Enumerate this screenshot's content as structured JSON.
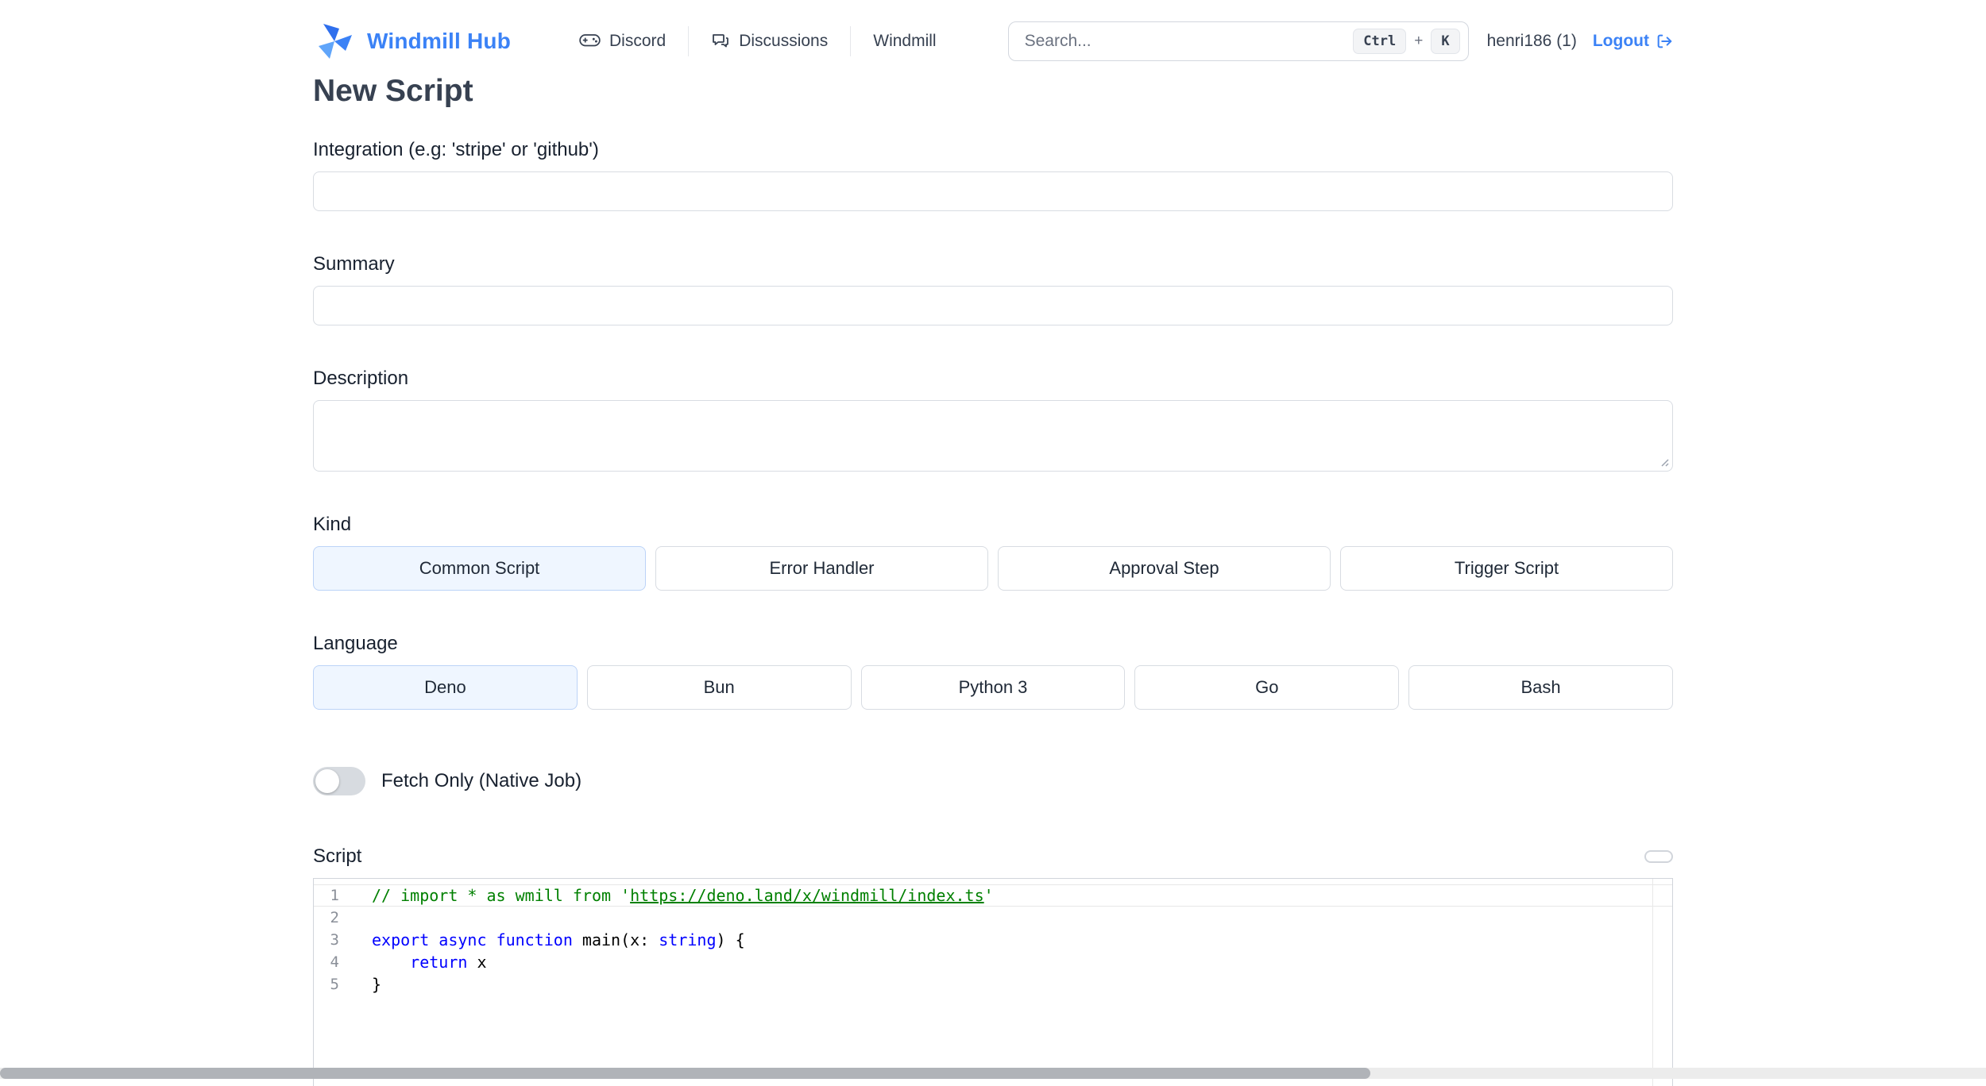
{
  "header": {
    "brand": "Windmill Hub",
    "nav": [
      {
        "label": "Discord"
      },
      {
        "label": "Discussions"
      },
      {
        "label": "Windmill"
      }
    ],
    "search": {
      "placeholder": "Search...",
      "keys": [
        "Ctrl",
        "K"
      ],
      "separator": "+"
    },
    "user": "henri186 (1)",
    "logout_label": "Logout"
  },
  "page": {
    "title": "New Script"
  },
  "form": {
    "integration": {
      "label": "Integration (e.g: 'stripe' or 'github')",
      "value": ""
    },
    "summary": {
      "label": "Summary",
      "value": ""
    },
    "description": {
      "label": "Description",
      "value": ""
    },
    "kind": {
      "label": "Kind",
      "options": [
        "Common Script",
        "Error Handler",
        "Approval Step",
        "Trigger Script"
      ],
      "selected": "Common Script"
    },
    "language": {
      "label": "Language",
      "options": [
        "Deno",
        "Bun",
        "Python 3",
        "Go",
        "Bash"
      ],
      "selected": "Deno"
    },
    "fetch_only": {
      "label": "Fetch Only (Native Job)",
      "enabled": false
    },
    "script": {
      "label": "Script"
    }
  },
  "editor": {
    "line_numbers": [
      "1",
      "2",
      "3",
      "4",
      "5"
    ],
    "lines": [
      {
        "tokens": [
          {
            "t": "// import * as wmill from '",
            "c": "comment"
          },
          {
            "t": "https://deno.land/x/windmill/index.ts",
            "c": "comment-link"
          },
          {
            "t": "'",
            "c": "comment"
          }
        ]
      },
      {
        "tokens": []
      },
      {
        "tokens": [
          {
            "t": "export",
            "c": "keyword"
          },
          {
            "t": " ",
            "c": "plain"
          },
          {
            "t": "async",
            "c": "keyword"
          },
          {
            "t": " ",
            "c": "plain"
          },
          {
            "t": "function",
            "c": "keyword"
          },
          {
            "t": " main(x: ",
            "c": "plain"
          },
          {
            "t": "string",
            "c": "keyword"
          },
          {
            "t": ") {",
            "c": "plain"
          }
        ]
      },
      {
        "tokens": [
          {
            "t": "    ",
            "c": "plain"
          },
          {
            "t": "return",
            "c": "keyword"
          },
          {
            "t": " x",
            "c": "plain"
          }
        ]
      },
      {
        "tokens": [
          {
            "t": "}",
            "c": "plain"
          }
        ]
      }
    ]
  },
  "colors": {
    "accent": "#3b82f6",
    "selected_option_bg": "#eff6ff",
    "code_comment": "#008000",
    "code_keyword": "#0000ff"
  }
}
